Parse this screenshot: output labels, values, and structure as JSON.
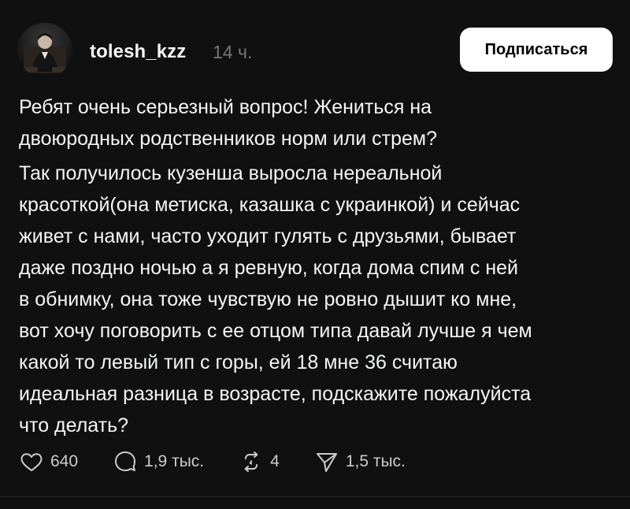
{
  "post": {
    "author": "tolesh_kzz",
    "time": "14 ч.",
    "follow_label": "Подписаться",
    "paragraphs": [
      "Ребят очень серьезный вопрос! Жениться на\nдвоюродных родственников норм или стрем?",
      "Так получилось кузенша выросла нереальной\nкрасоткой(она метиска, казашка с украинкой) и сейчас\nживет с нами, часто уходит гулять с друзьями, бывает\nдаже поздно ночью а я ревную, когда дома спим с ней\nв обнимку, она тоже чувствую не ровно дышит ко мне,\nвот хочу поговорить с ее отцом типа давай лучше я чем\nкакой то левый тип с горы, ей 18 мне 36 считаю\nидеальная разница в возрасте, подскажите пожалуйста\nчто делать?"
    ],
    "actions": {
      "likes": "640",
      "replies": "1,9 тыс.",
      "reposts": "4",
      "shares": "1,5 тыс."
    }
  },
  "icons": {
    "like": "heart-icon",
    "reply": "comment-bubble-icon",
    "repost": "repost-icon",
    "share": "send-icon"
  },
  "colors": {
    "background": "#101010",
    "text": "#f3f5f7",
    "muted": "#777777",
    "button_bg": "#ffffff",
    "button_text": "#000000"
  }
}
